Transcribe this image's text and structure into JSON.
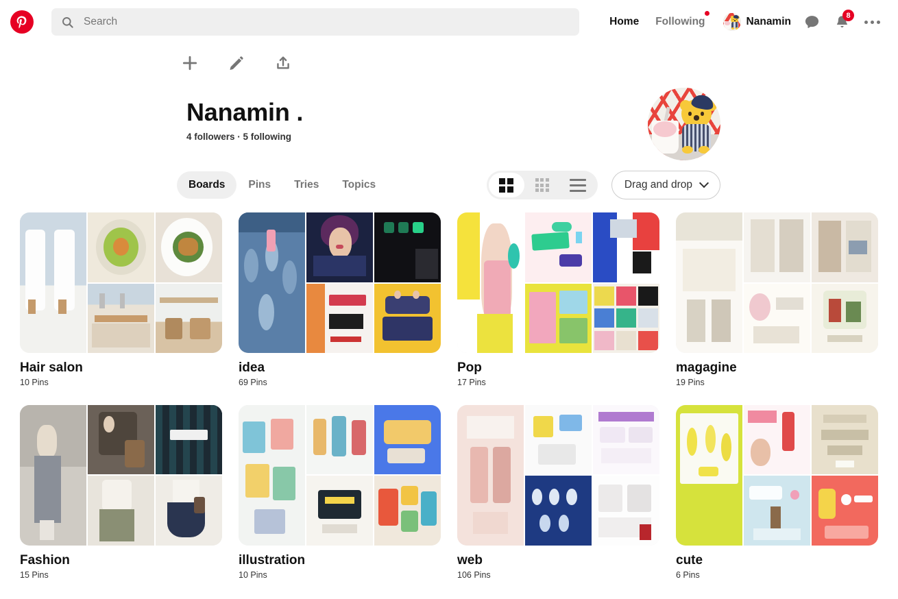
{
  "header": {
    "logo_icon": "pinterest-logo-icon",
    "search": {
      "icon": "search-icon",
      "placeholder": "Search",
      "value": ""
    },
    "nav": [
      {
        "label": "Home",
        "active": true,
        "has_dot": false
      },
      {
        "label": "Following",
        "active": false,
        "has_dot": true
      }
    ],
    "user": {
      "name": "Nanamin",
      "avatar_alt": "pooh-plush-avatar"
    },
    "messages_icon": "chat-bubble-icon",
    "notifications_icon": "bell-icon",
    "notifications_count": "8",
    "more_icon": "more-horizontal-icon"
  },
  "actions": [
    {
      "name": "add-icon",
      "label": "plus"
    },
    {
      "name": "edit-icon",
      "label": "pencil"
    },
    {
      "name": "share-icon",
      "label": "upload"
    }
  ],
  "profile": {
    "display_name": "Nanamin .",
    "meta": "4 followers · 5 following",
    "followers": "4 followers",
    "following": "5 following"
  },
  "tabs": [
    {
      "label": "Boards",
      "active": true
    },
    {
      "label": "Pins",
      "active": false
    },
    {
      "label": "Tries",
      "active": false
    },
    {
      "label": "Topics",
      "active": false
    }
  ],
  "view_toggle": [
    {
      "name": "grid-2x2-icon",
      "active": true
    },
    {
      "name": "grid-3x3-icon",
      "active": false
    },
    {
      "name": "list-view-icon",
      "active": false
    }
  ],
  "sort": {
    "label": "Drag and drop",
    "icon": "chevron-down-icon"
  },
  "boards": [
    {
      "name": "Hair salon",
      "pins": "10 Pins"
    },
    {
      "name": "idea",
      "pins": "69 Pins"
    },
    {
      "name": "Pop",
      "pins": "17 Pins"
    },
    {
      "name": "magagine",
      "pins": "19 Pins"
    },
    {
      "name": "Fashion",
      "pins": "15 Pins"
    },
    {
      "name": "illustration",
      "pins": "10 Pins"
    },
    {
      "name": "web",
      "pins": "106 Pins"
    },
    {
      "name": "cute",
      "pins": "6 Pins"
    }
  ],
  "colors": {
    "brand_red": "#e60023",
    "text_primary": "#111111",
    "text_secondary": "#767676",
    "field_bg": "#efefef"
  }
}
